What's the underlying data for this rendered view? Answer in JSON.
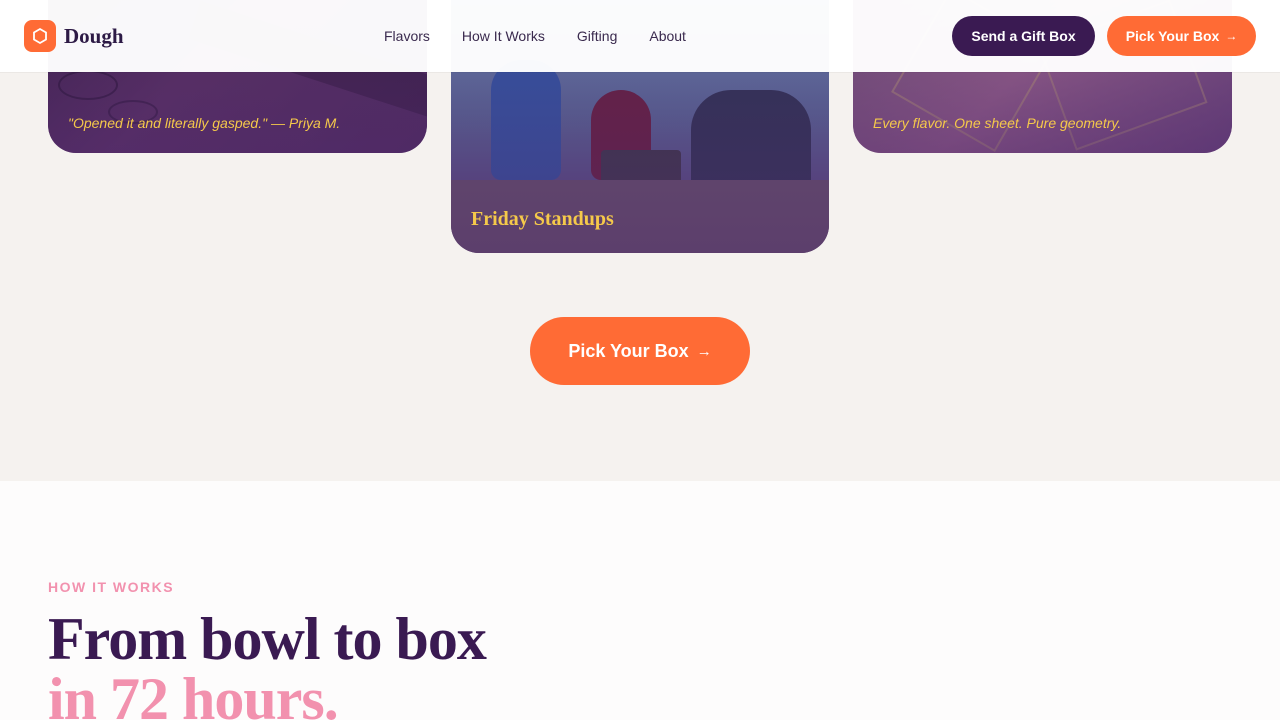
{
  "header": {
    "brand": "Dough",
    "nav": [
      "Flavors",
      "How It Works",
      "Gifting",
      "About"
    ],
    "gift_button": "Send a Gift Box",
    "pick_button": "Pick Your Box",
    "arrow": "→"
  },
  "gallery": {
    "left_caption": "\"Opened it and literally gasped.\" — Priya M.",
    "mid_caption": "Friday Standups",
    "right_caption": "Every flavor. One sheet. Pure geometry."
  },
  "cta": {
    "label": "Pick Your Box",
    "arrow": "→"
  },
  "how_it_works": {
    "eyebrow": "HOW IT WORKS",
    "headline_line1": "From bowl to box",
    "headline_line2": "in 72 hours."
  },
  "colors": {
    "brand_orange": "#ff6b35",
    "brand_purple": "#3a1a52",
    "accent_pink": "#f291ae",
    "caption_gold": "#f5c94a"
  }
}
